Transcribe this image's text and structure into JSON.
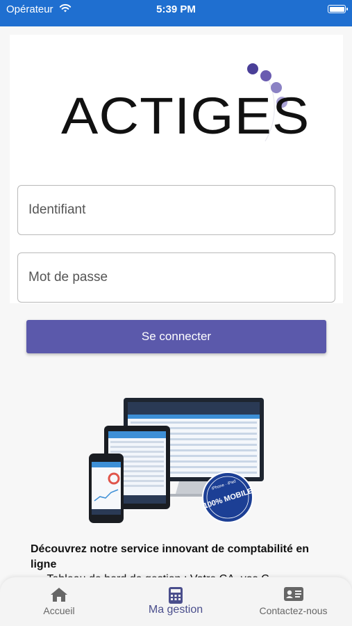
{
  "status_bar": {
    "carrier": "Opérateur",
    "time": "5:39 PM"
  },
  "logo": {
    "text": "ACTIGES",
    "dot_colors": [
      "#4a3f98",
      "#6a5cb0",
      "#8b82c4",
      "#aaa3d6"
    ]
  },
  "form": {
    "username_placeholder": "Identifiant",
    "password_placeholder": "Mot de passe",
    "submit_label": "Se connecter"
  },
  "promo": {
    "badge_text": "100% MOBILE",
    "badge_subtext": "iPhone · iPad",
    "headline": "Découvrez notre service innovant de comptabilité en ligne",
    "first_item": "- Tableau de bord de gestion : Votre CA, vos C..."
  },
  "tabbar": {
    "tabs": [
      {
        "label": "Accueil",
        "icon": "home-icon",
        "active": false
      },
      {
        "label": "Ma gestion",
        "icon": "calculator-icon",
        "active": true
      },
      {
        "label": "Contactez-nous",
        "icon": "contact-card-icon",
        "active": false
      }
    ]
  },
  "colors": {
    "status_bar": "#1f6fd0",
    "button": "#5b59ab",
    "active_tab": "#4a4e8c",
    "badge": "#1c3f95"
  }
}
